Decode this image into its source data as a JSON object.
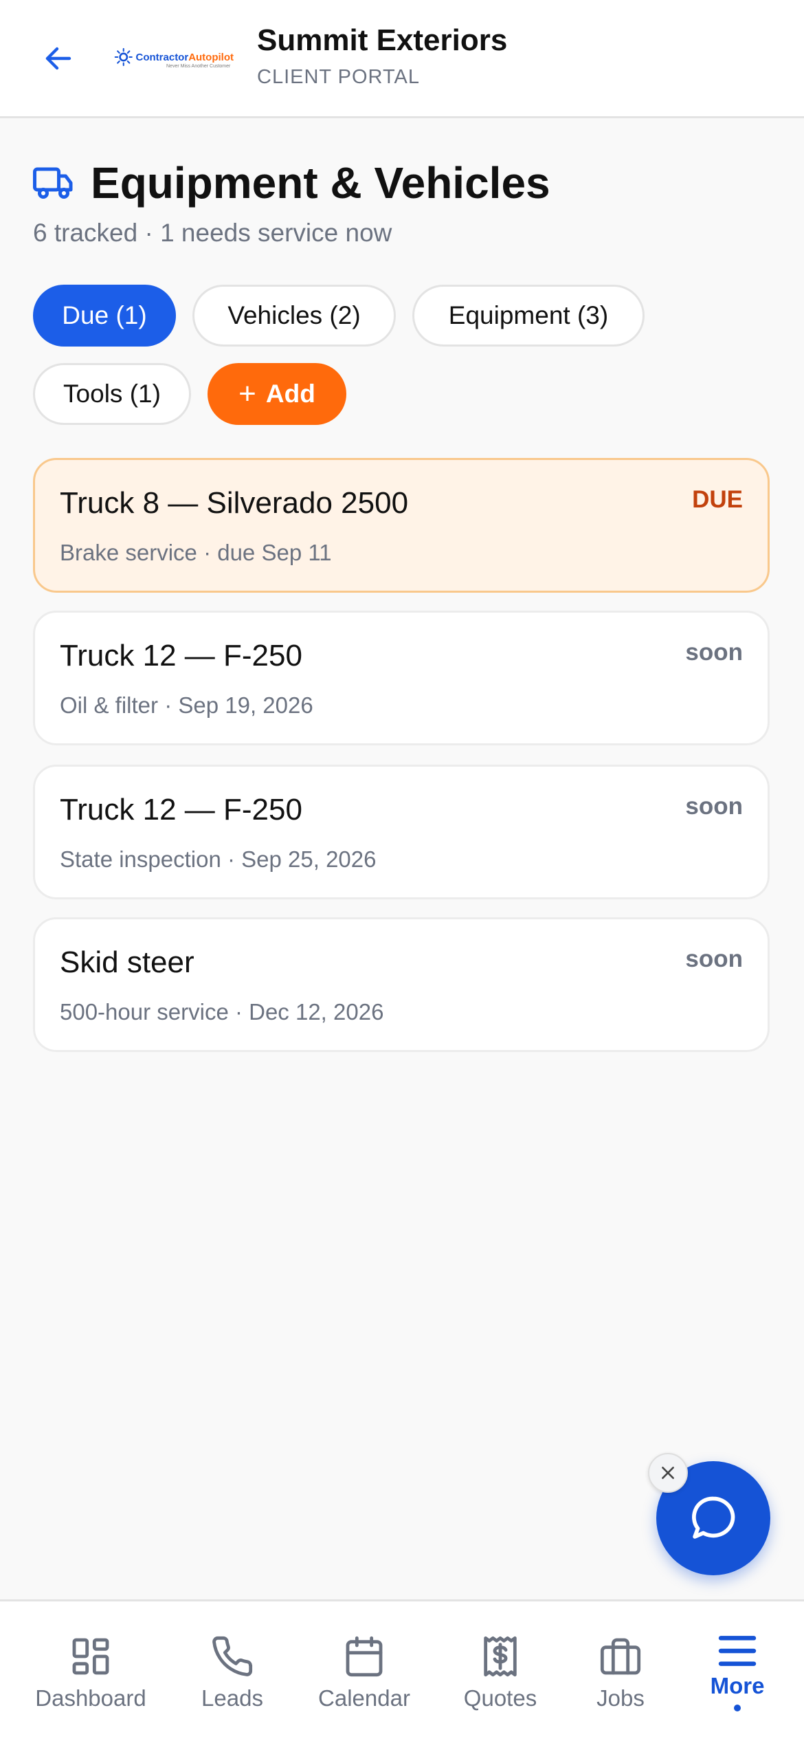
{
  "header": {
    "company_name": "Summit Exteriors",
    "portal_label": "CLIENT PORTAL",
    "logo_primary": "Contractor",
    "logo_accent": "Autopilot",
    "logo_tagline": "Never Miss Another Customer"
  },
  "page": {
    "title": "Equipment & Vehicles",
    "subtitle": "6 tracked · 1 needs service now",
    "icon": "truck-icon"
  },
  "filters": [
    {
      "label": "Due (1)",
      "active": true
    },
    {
      "label": "Vehicles (2)",
      "active": false
    },
    {
      "label": "Equipment (3)",
      "active": false
    },
    {
      "label": "Tools (1)",
      "active": false
    }
  ],
  "add_button": {
    "label": "Add",
    "icon": "plus-icon"
  },
  "items": [
    {
      "title": "Truck 8 — Silverado 2500",
      "detail": "Brake service · due Sep 11",
      "status": "DUE"
    },
    {
      "title": "Truck 12 — F-250",
      "detail": "Oil & filter · Sep 19, 2026",
      "status": "soon"
    },
    {
      "title": "Truck 12 — F-250",
      "detail": "State inspection · Sep 25, 2026",
      "status": "soon"
    },
    {
      "title": "Skid steer",
      "detail": "500-hour service · Dec 12, 2026",
      "status": "soon"
    }
  ],
  "nav": {
    "items": [
      {
        "label": "Dashboard",
        "icon": "grid-icon"
      },
      {
        "label": "Leads",
        "icon": "phone-icon"
      },
      {
        "label": "Calendar",
        "icon": "calendar-icon"
      },
      {
        "label": "Quotes",
        "icon": "receipt-icon"
      },
      {
        "label": "Jobs",
        "icon": "briefcase-icon"
      },
      {
        "label": "More",
        "icon": "menu-icon",
        "active": true
      }
    ]
  },
  "colors": {
    "primary": "#1c5ee8",
    "accent_orange": "#ff6a0c",
    "due_text": "#c2410c",
    "due_bg": "#fff3e7",
    "muted": "#6b7280"
  }
}
